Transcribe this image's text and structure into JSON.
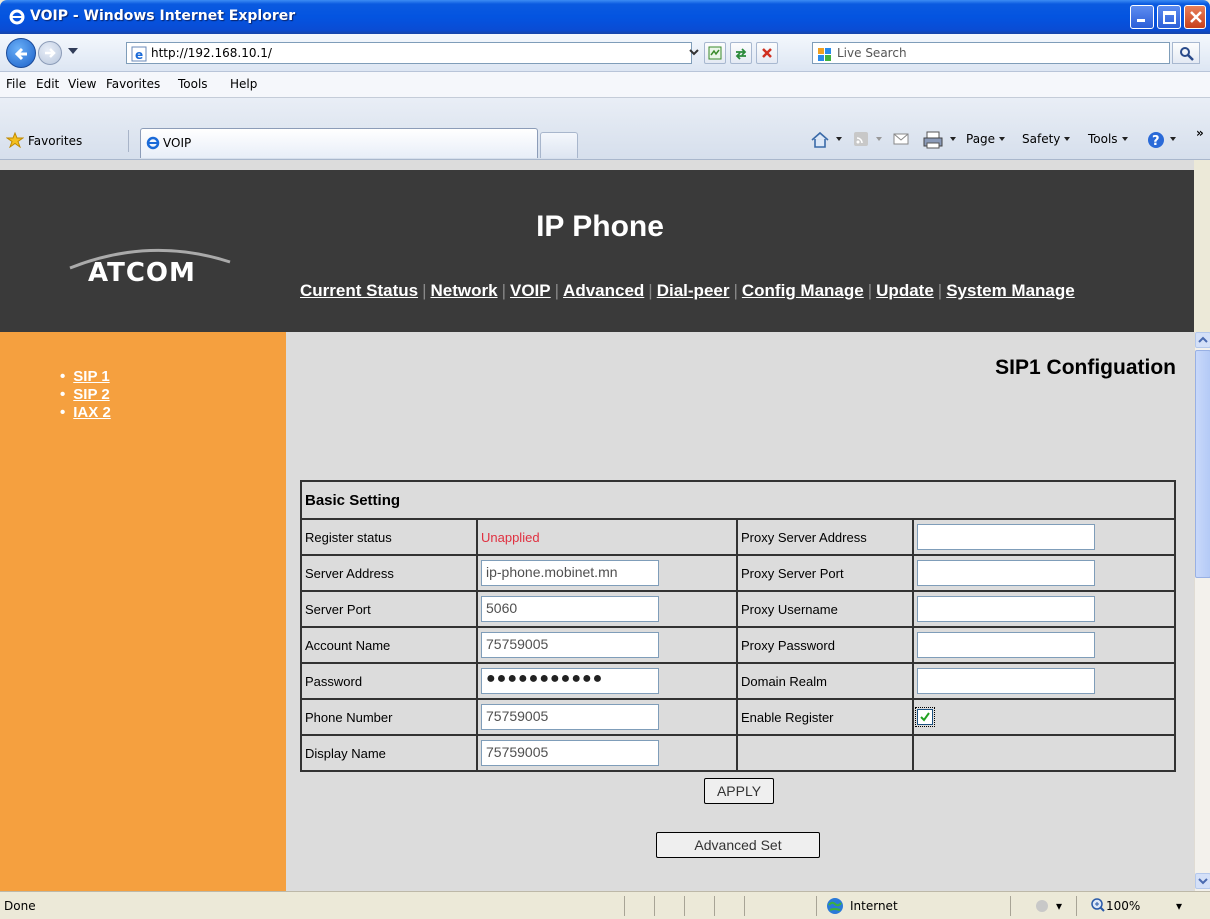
{
  "window": {
    "title": "VOIP - Windows Internet Explorer"
  },
  "address": {
    "url": "http://192.168.10.1/",
    "search_placeholder": "Live Search"
  },
  "menu": [
    "File",
    "Edit",
    "View",
    "Favorites",
    "Tools",
    "Help"
  ],
  "favbar": {
    "favorites_label": "Favorites",
    "tab_label": "VOIP",
    "commands": [
      "Page",
      "Safety",
      "Tools"
    ]
  },
  "header": {
    "logo": "ATCOM",
    "title": "IP Phone",
    "nav": [
      "Current Status",
      "Network",
      "VOIP",
      "Advanced",
      "Dial-peer",
      "Config Manage",
      "Update",
      "System Manage"
    ]
  },
  "sidebar": {
    "items": [
      "SIP 1",
      "SIP 2",
      "IAX 2"
    ]
  },
  "content": {
    "heading": "SIP1 Configuation",
    "section": "Basic Setting",
    "left_fields": [
      {
        "label": "Register status",
        "value": "Unapplied"
      },
      {
        "label": "Server Address",
        "value": "ip-phone.mobinet.mn"
      },
      {
        "label": "Server Port",
        "value": "5060"
      },
      {
        "label": "Account Name",
        "value": "75759005"
      },
      {
        "label": "Password",
        "value": "●●●●●●●●●●●"
      },
      {
        "label": "Phone Number",
        "value": "75759005"
      },
      {
        "label": "Display Name",
        "value": "75759005"
      }
    ],
    "right_fields": [
      {
        "label": "Proxy Server Address",
        "value": ""
      },
      {
        "label": "Proxy Server Port",
        "value": ""
      },
      {
        "label": "Proxy Username",
        "value": ""
      },
      {
        "label": "Proxy Password",
        "value": ""
      },
      {
        "label": "Domain Realm",
        "value": ""
      },
      {
        "label": "Enable Register",
        "checked": true
      }
    ],
    "apply_label": "APPLY",
    "advanced_label": "Advanced Set"
  },
  "status": {
    "text": "Done",
    "zone": "Internet",
    "zoom": "100%"
  },
  "colors": {
    "header_bg": "#3a3a3a",
    "sidebar_bg": "#f5a03f",
    "content_bg": "#dcdcdc",
    "unapplied": "#e03040"
  }
}
